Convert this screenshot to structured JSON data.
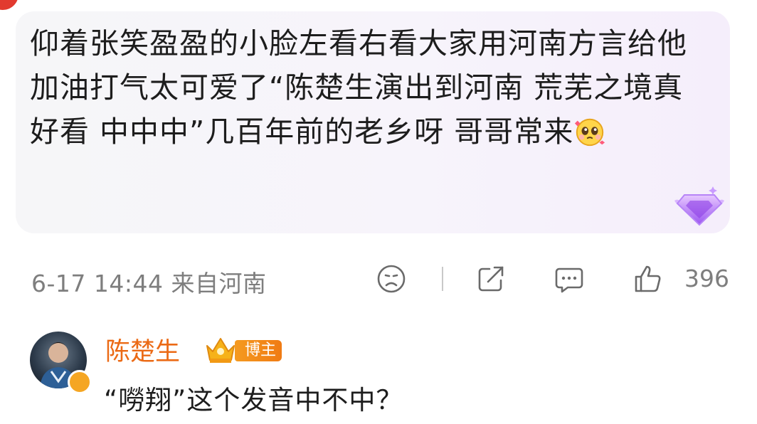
{
  "comment": {
    "text": "仰着张笑盈盈的小脸左看右看大家用河南方言给他加油打气太可爱了“陈楚生演出到河南 荒芜之境真好看 中中中”几百年前的老乡呀 哥哥常来",
    "emoji_icon": "pleading-face-emoji",
    "badge_icon": "purple-diamond-fan-badge"
  },
  "meta": {
    "time_location": "6-17 14:44 来自河南",
    "actions": [
      "dislike-face-icon",
      "share-icon",
      "comment-icon",
      "like-icon"
    ],
    "like_count": "396"
  },
  "reply": {
    "author": "陈楚生",
    "author_badge": "博主",
    "text": "“嘮翔”这个发音中不中？",
    "colors": {
      "name": "#eb6a15",
      "badge": "#f28a1a"
    }
  }
}
